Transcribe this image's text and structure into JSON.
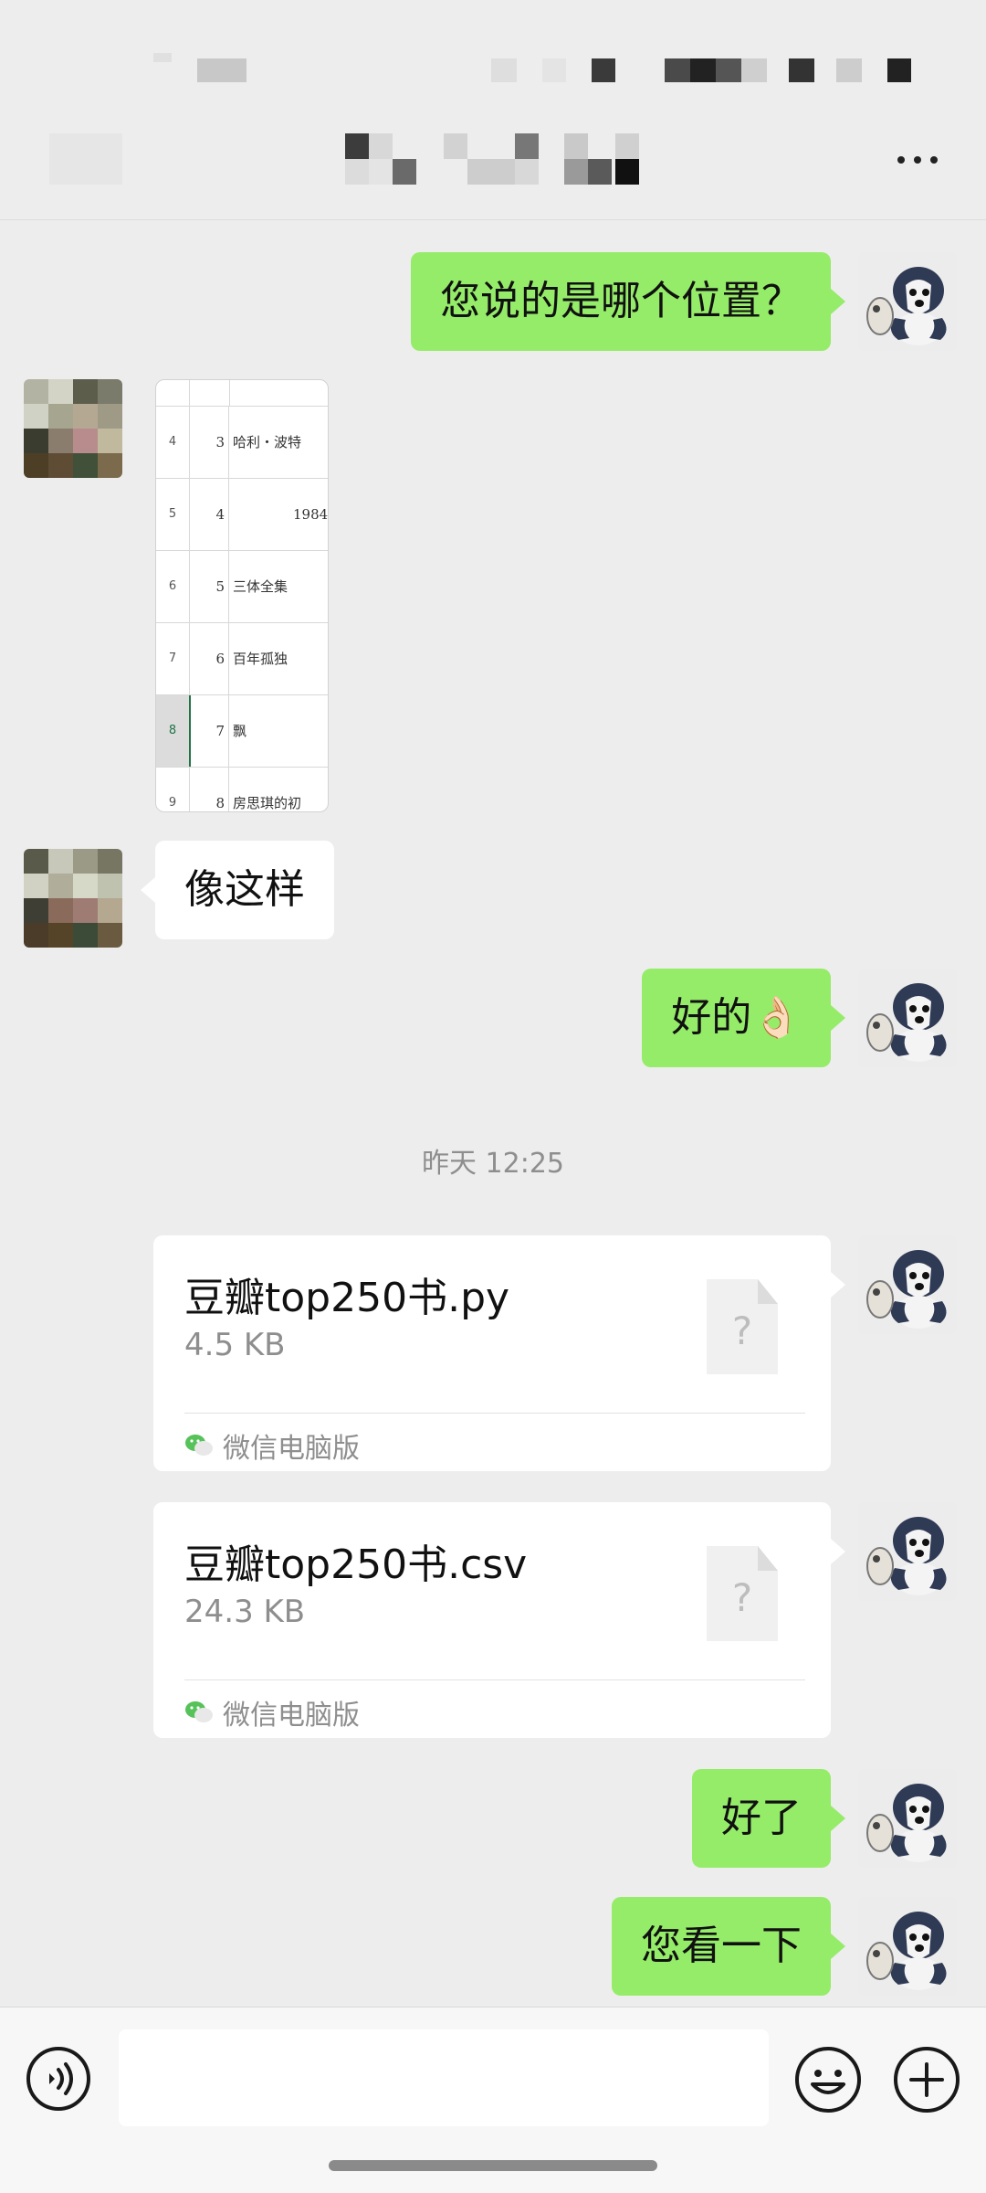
{
  "messages": [
    {
      "text": "您说的是哪个位置？"
    },
    {
      "image_rows": [
        {
          "row": "4",
          "idx": "3",
          "title": "哈利・波特"
        },
        {
          "row": "5",
          "idx": "4",
          "title": "1984"
        },
        {
          "row": "6",
          "idx": "5",
          "title": "三体全集"
        },
        {
          "row": "7",
          "idx": "6",
          "title": "百年孤独"
        },
        {
          "row": "8",
          "idx": "7",
          "title": "飘"
        },
        {
          "row": "9",
          "idx": "8",
          "title": "房思琪的初"
        }
      ]
    },
    {
      "text": "像这样"
    },
    {
      "text": "好的👌🏻"
    },
    {
      "text": "好了"
    },
    {
      "text": "您看一下"
    }
  ],
  "timestamp": "昨天 12:25",
  "files": [
    {
      "name": "豆瓣top250书.py",
      "size": "4.5 KB",
      "source": "微信电脑版"
    },
    {
      "name": "豆瓣top250书.csv",
      "size": "24.3 KB",
      "source": "微信电脑版"
    }
  ],
  "icons": {
    "more": "more-dots-icon",
    "voice": "voice-icon",
    "emoji": "emoji-icon",
    "plus": "plus-icon",
    "file": "unknown-file-icon",
    "source": "wechat-icon"
  },
  "colors": {
    "background": "#ededed",
    "my_bubble": "#95ec69",
    "other_bubble": "#ffffff",
    "meta_text": "#8e8e8e"
  }
}
